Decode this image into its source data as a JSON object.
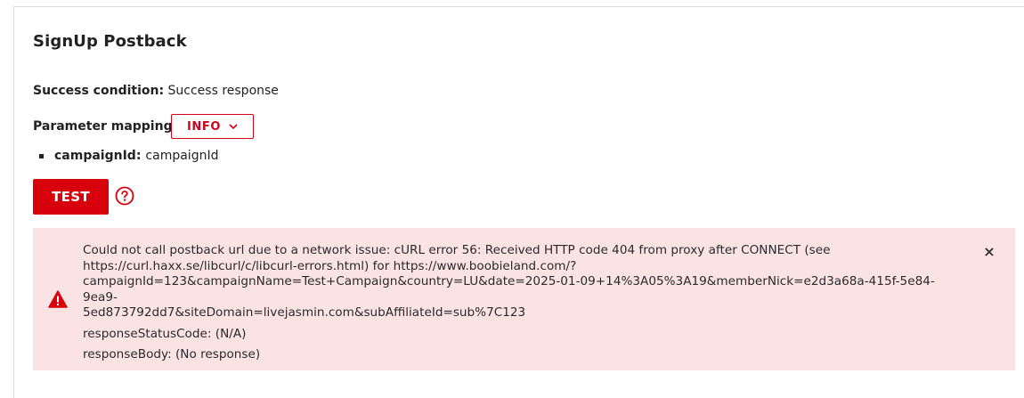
{
  "section": {
    "title": "SignUp Postback"
  },
  "success": {
    "label": "Success condition:",
    "value": "Success response"
  },
  "mapping": {
    "label": "Parameter mapping",
    "info_button_label": "INFO",
    "items": [
      {
        "key": "campaignId:",
        "value": "campaignId"
      }
    ]
  },
  "test": {
    "button_label": "TEST",
    "help_icon": "question-circle-icon"
  },
  "alert": {
    "icon": "warning-triangle-icon",
    "close_glyph": "×",
    "message_line1": "Could not call postback url due to a network issue: cURL error 56: Received HTTP code 404 from proxy after CONNECT (see",
    "message_line2": "https://curl.haxx.se/libcurl/c/libcurl-errors.html) for https://www.boobieland.com/?",
    "message_line3": "campaignId=123&campaignName=Test+Campaign&country=LU&date=2025-01-09+14%3A05%3A19&memberNick=e2d3a68a-415f-5e84-9ea9-",
    "message_line4": "5ed873792dd7&siteDomain=livejasmin.com&subAffiliateId=sub%7C123",
    "status_code": "responseStatusCode: (N/A)",
    "body": "responseBody: (No response)"
  },
  "colors": {
    "accent": "#d9000d",
    "alert_bg": "#fbe3e4"
  }
}
